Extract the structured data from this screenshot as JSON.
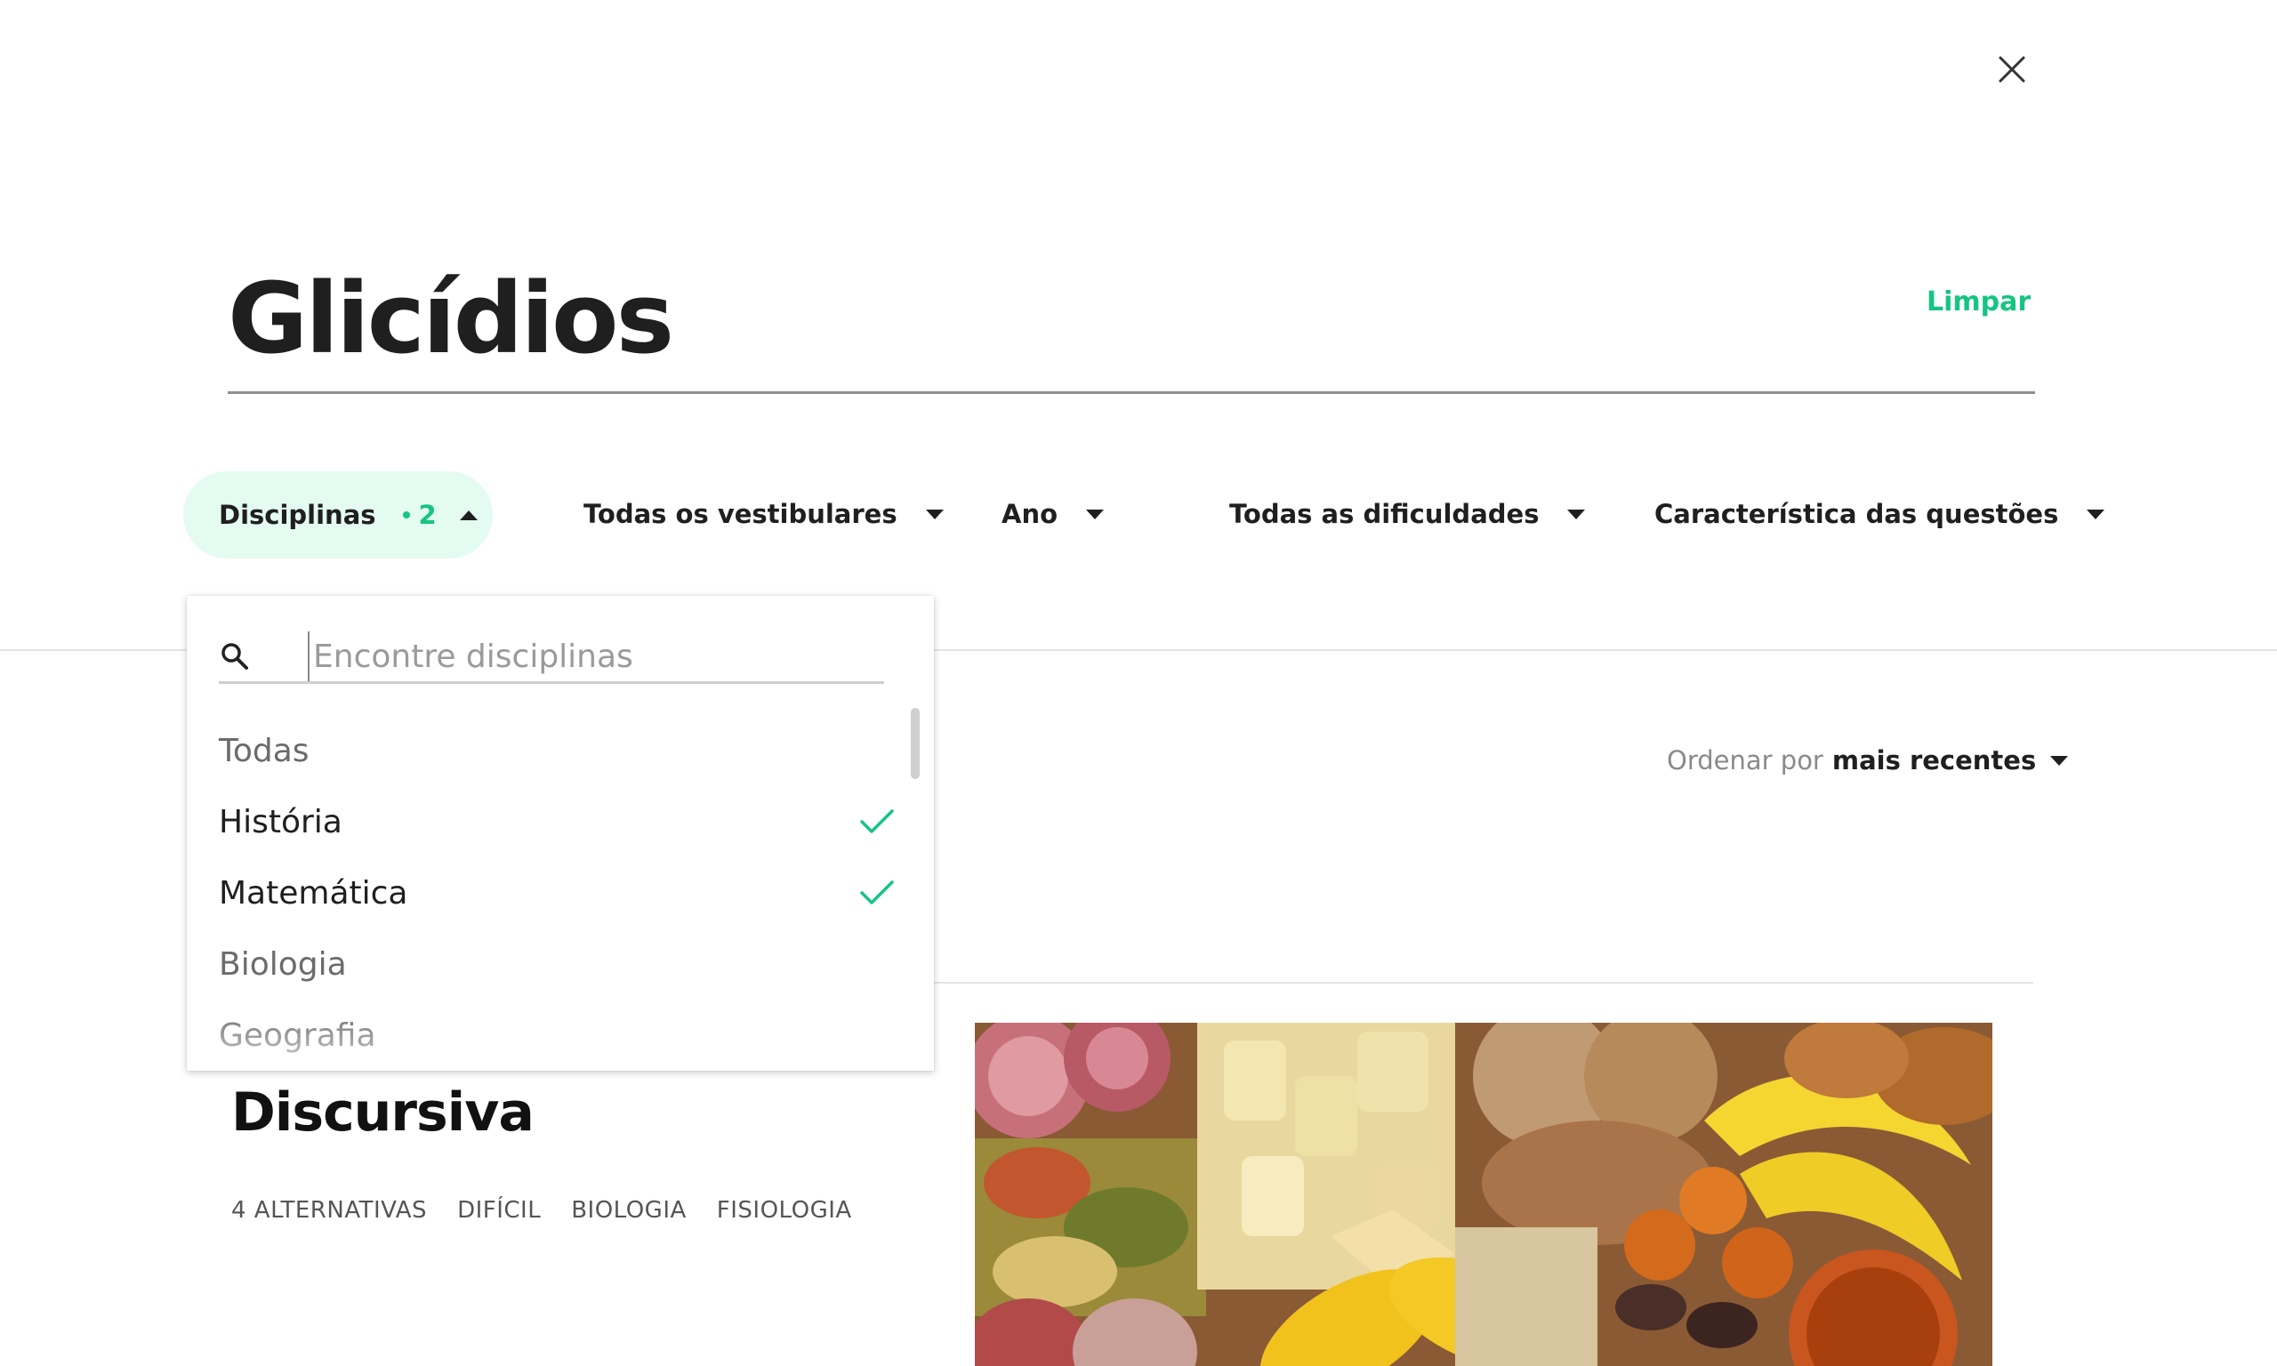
{
  "header": {
    "title": "Glicídios",
    "clear_label": "Limpar"
  },
  "filters": {
    "disciplines": {
      "label": "Disciplinas",
      "count": "2"
    },
    "exams": "Todas os vestibulares",
    "year": "Ano",
    "difficulty": "Todas as dificuldades",
    "characteristics": "Característica das questões"
  },
  "dropdown": {
    "search_placeholder": "Encontre disciplinas",
    "options": [
      {
        "label": "Todas",
        "selected": false
      },
      {
        "label": "História",
        "selected": true
      },
      {
        "label": "Matemática",
        "selected": true
      },
      {
        "label": "Biologia",
        "selected": false
      },
      {
        "label": "Geografia",
        "selected": false
      }
    ]
  },
  "sort": {
    "prefix": "Ordenar por",
    "value": "mais recentes"
  },
  "card": {
    "title": "Discursiva",
    "tags": [
      "4 ALTERNATIVAS",
      "DIFÍCIL",
      "BIOLOGIA",
      "FISIOLOGIA"
    ]
  },
  "icons": {
    "close": "close-icon",
    "search": "search-icon",
    "check": "check-icon",
    "caret": "caret-down-icon"
  },
  "colors": {
    "accent": "#16c483",
    "pill_background": "#e4fbf1",
    "text": "#1f1f1f"
  }
}
